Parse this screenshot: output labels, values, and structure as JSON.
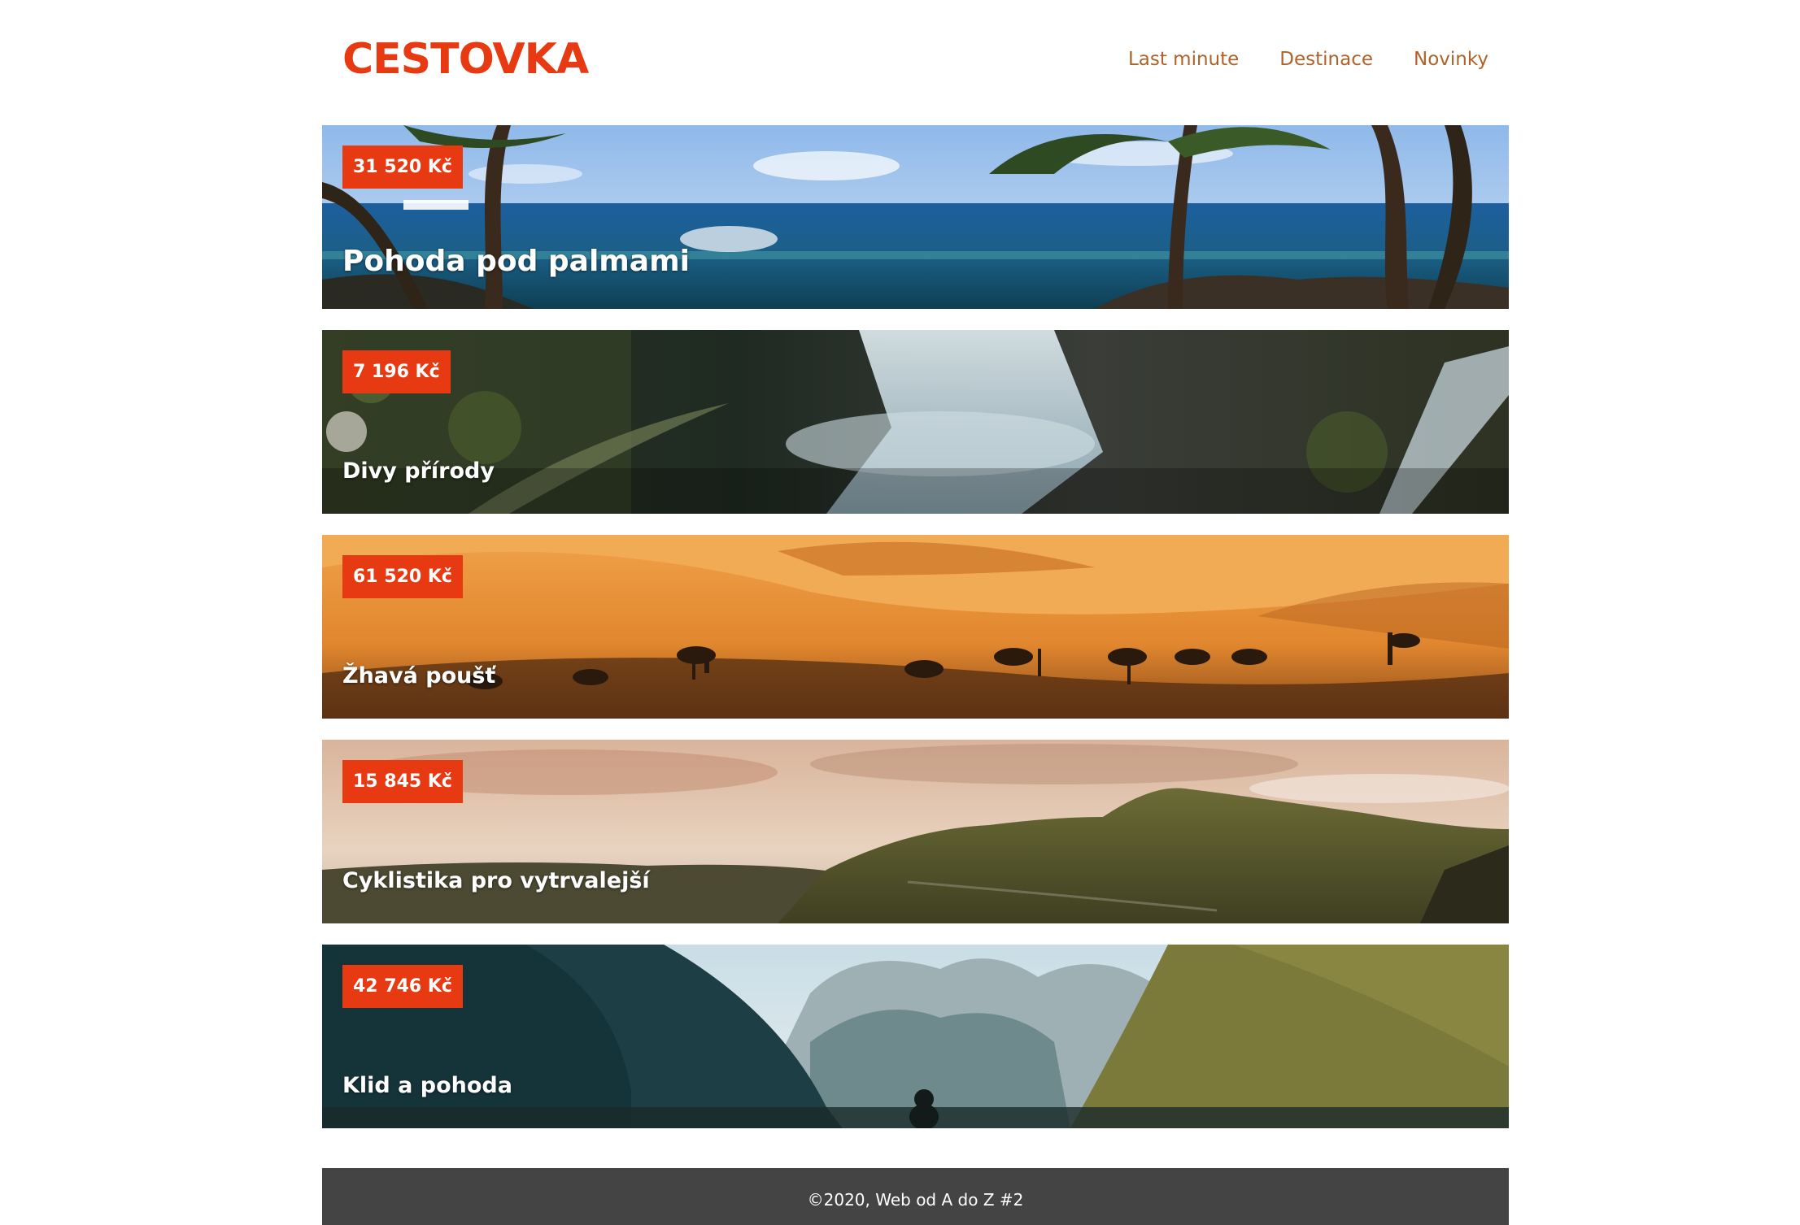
{
  "header": {
    "logo": "CESTOVKA",
    "nav": [
      "Last minute",
      "Destinace",
      "Novinky"
    ]
  },
  "trips": [
    {
      "price": "31 520 Kč",
      "title": "Pohoda pod palmami",
      "image": "beach-palms-photo"
    },
    {
      "price": "7 196 Kč",
      "title": "Divy přírody",
      "image": "waterfall-photo"
    },
    {
      "price": "61 520 Kč",
      "title": "Žhavá poušť",
      "image": "desert-camels-photo"
    },
    {
      "price": "15 845 Kč",
      "title": "Cyklistika pro vytrvalejší",
      "image": "green-hills-photo"
    },
    {
      "price": "42 746 Kč",
      "title": "Klid a pohoda",
      "image": "mountain-lake-photo"
    }
  ],
  "footer": {
    "text": "©2020, Web od A do Z #2"
  },
  "colors": {
    "accent": "#e83a12",
    "nav": "#b0622a",
    "footer_bg": "#444444"
  }
}
